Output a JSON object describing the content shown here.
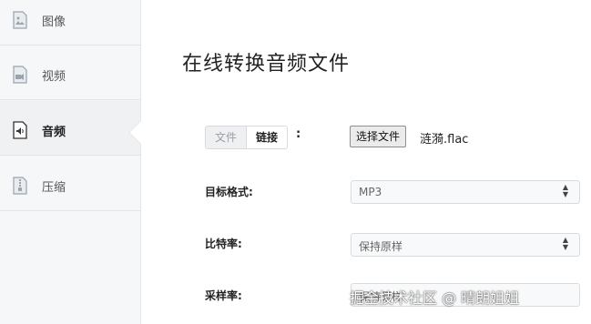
{
  "sidebar": {
    "items": [
      {
        "label": "图像",
        "icon": "image-file-icon"
      },
      {
        "label": "视频",
        "icon": "video-file-icon"
      },
      {
        "label": "音频",
        "icon": "audio-file-icon",
        "active": true
      },
      {
        "label": "压缩",
        "icon": "zip-file-icon"
      }
    ]
  },
  "main": {
    "title": "在线转换音频文件",
    "source_tabs": {
      "file": "文件",
      "link": "链接"
    },
    "colon": ":",
    "file_button": "选择文件",
    "file_name": "涟漪.flac",
    "fields": {
      "format": {
        "label": "目标格式:",
        "value": "MP3"
      },
      "bitrate": {
        "label": "比特率:",
        "value": "保持原样"
      },
      "samplerate": {
        "label": "采样率:",
        "value": "保持原样"
      }
    }
  },
  "watermark": "掘金技术社区 @ 晴朗姐姐",
  "colors": {
    "sidebar_bg": "#f6f7f9",
    "border": "#e3e5e8",
    "text": "#222222"
  }
}
